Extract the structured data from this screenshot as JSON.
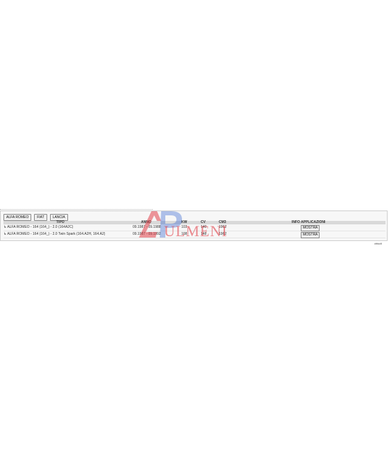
{
  "brands": [
    "ALFA ROMEO",
    "FIAT",
    "LANCIA"
  ],
  "table": {
    "headers": {
      "tipo": "TIPO",
      "anno": "ANNO",
      "kw": "KW",
      "cv": "CV",
      "cm3": "CM3",
      "info": "INFO APPLICAZIONI"
    },
    "rows": [
      {
        "tipo": "ALFA ROMEO - 164 (164_) - 2.0 (164A2C)",
        "anno": "09.1987 - 09.1988",
        "kw": "103",
        "cv": "140",
        "cm3": "1962",
        "button": "MOSTRA"
      },
      {
        "tipo": "ALFA ROMEO - 164 (164_) - 2.0 Twin Spark (164.A2H, 164.A2)",
        "anno": "09.1987 - 09.1992",
        "kw": "108",
        "cv": "148",
        "cm3": "1962",
        "button": "MOSTRA"
      }
    ]
  },
  "watermark": {
    "text": "ULMENI",
    "color": "#e0303a"
  },
  "footer": {
    "link": "chiudi"
  }
}
